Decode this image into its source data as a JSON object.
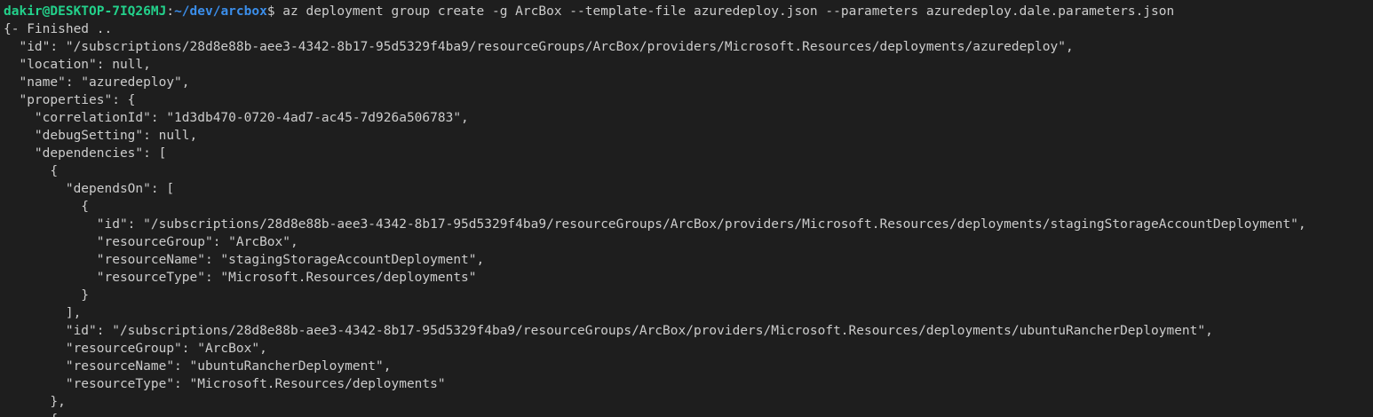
{
  "terminal": {
    "prompt": {
      "user_host": "dakir@DESKTOP-7IQ26MJ",
      "separator": ":",
      "path": "~/dev/arcbox",
      "symbol": "$"
    },
    "command": " az deployment group create -g ArcBox --template-file azuredeploy.json --parameters azuredeploy.dale.parameters.json",
    "output_lines": [
      "{- Finished ..",
      "  \"id\": \"/subscriptions/28d8e88b-aee3-4342-8b17-95d5329f4ba9/resourceGroups/ArcBox/providers/Microsoft.Resources/deployments/azuredeploy\",",
      "  \"location\": null,",
      "  \"name\": \"azuredeploy\",",
      "  \"properties\": {",
      "    \"correlationId\": \"1d3db470-0720-4ad7-ac45-7d926a506783\",",
      "    \"debugSetting\": null,",
      "    \"dependencies\": [",
      "      {",
      "        \"dependsOn\": [",
      "          {",
      "            \"id\": \"/subscriptions/28d8e88b-aee3-4342-8b17-95d5329f4ba9/resourceGroups/ArcBox/providers/Microsoft.Resources/deployments/stagingStorageAccountDeployment\",",
      "            \"resourceGroup\": \"ArcBox\",",
      "            \"resourceName\": \"stagingStorageAccountDeployment\",",
      "            \"resourceType\": \"Microsoft.Resources/deployments\"",
      "          }",
      "        ],",
      "        \"id\": \"/subscriptions/28d8e88b-aee3-4342-8b17-95d5329f4ba9/resourceGroups/ArcBox/providers/Microsoft.Resources/deployments/ubuntuRancherDeployment\",",
      "        \"resourceGroup\": \"ArcBox\",",
      "        \"resourceName\": \"ubuntuRancherDeployment\",",
      "        \"resourceType\": \"Microsoft.Resources/deployments\"",
      "      },",
      "      {"
    ],
    "colors": {
      "background": "#1e1e1e",
      "foreground": "#cccccc",
      "user_host": "#23d18b",
      "path": "#3b8eea"
    }
  }
}
